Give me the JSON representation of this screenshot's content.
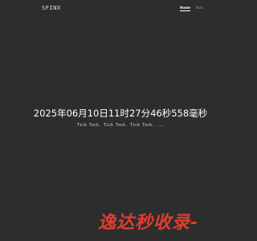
{
  "navbar": {
    "brand": "SFINX",
    "links": [
      {
        "label": "Home",
        "active": true
      },
      {
        "label": "Tools",
        "active": false
      }
    ]
  },
  "hero": {
    "clock_text": "2025年06月10日11时27分46秒558毫秒",
    "subtitle": "Tick Tock. Tick Tock. Tick Tock. ..."
  },
  "watermark": {
    "text": "逸达秒收录-"
  },
  "colors": {
    "background": "#2d2d2d",
    "text": "#ffffff",
    "watermark": "#e23d2c"
  }
}
